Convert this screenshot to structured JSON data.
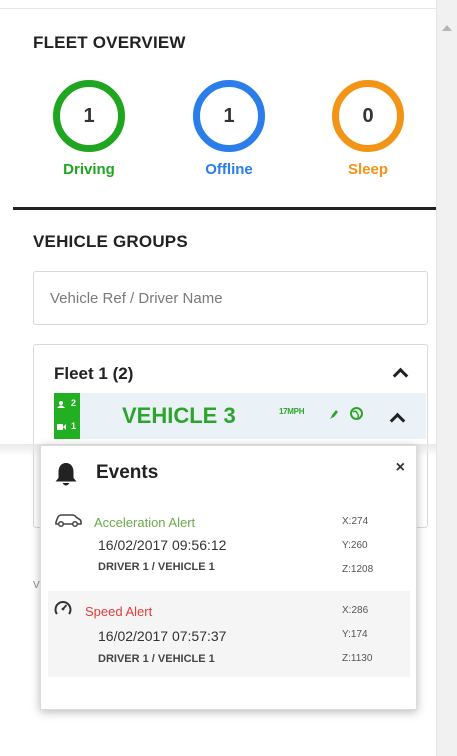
{
  "fleet_overview": {
    "title": "FLEET OVERVIEW",
    "statuses": [
      {
        "count": "1",
        "label": "Driving",
        "color": "#1fa51f"
      },
      {
        "count": "1",
        "label": "Offline",
        "color": "#2b7de9"
      },
      {
        "count": "0",
        "label": "Sleep",
        "color": "#f29415"
      }
    ]
  },
  "vehicle_groups": {
    "title": "VEHICLE GROUPS",
    "search_placeholder": "Vehicle Ref / Driver Name",
    "group": {
      "name": "Fleet 1 (2)",
      "vehicle": {
        "name": "VEHICLE 3",
        "badge_top": "2",
        "badge_bottom": "1",
        "speed": "17MPH"
      }
    }
  },
  "events_popup": {
    "title": "Events",
    "close": "×",
    "events": [
      {
        "type": "Acceleration Alert",
        "type_color": "#6aab4a",
        "icon": "car-icon",
        "datetime": "16/02/2017 09:56:12",
        "driver": "DRIVER 1 / VEHICLE 1",
        "x": "X:274",
        "y": "Y:260",
        "z": "Z:1208"
      },
      {
        "type": "Speed Alert",
        "type_color": "#e23c3c",
        "icon": "speedometer-icon",
        "datetime": "16/02/2017 07:57:37",
        "driver": "DRIVER 1 / VEHICLE 1",
        "x": "X:286",
        "y": "Y:174",
        "z": "Z:1130"
      }
    ]
  },
  "background_fragment": "V"
}
